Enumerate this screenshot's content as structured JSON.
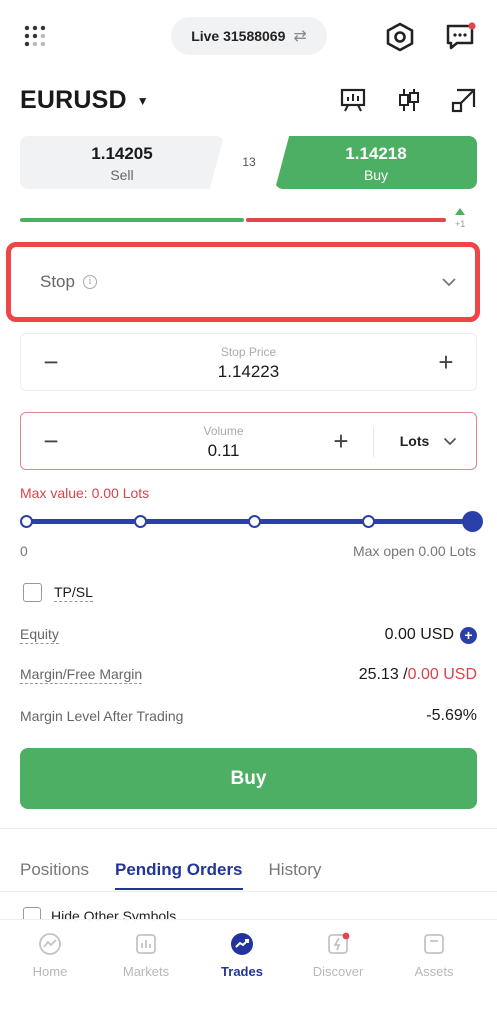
{
  "top_bar": {
    "account_label": "Live 31588069",
    "swap_icon": "⇄"
  },
  "symbol": {
    "name": "EURUSD",
    "caret": "▼"
  },
  "quote": {
    "sell_price": "1.14205",
    "sell_label": "Sell",
    "spread": "13",
    "buy_price": "1.14218",
    "buy_label": "Buy",
    "sentiment_delta": "+1"
  },
  "order_type": {
    "label": "Stop",
    "info_glyph": "i"
  },
  "stop_price": {
    "label": "Stop Price",
    "value": "1.14223",
    "minus": "−",
    "plus": "+"
  },
  "volume": {
    "label": "Volume",
    "value": "0.11",
    "minus": "−",
    "plus": "+",
    "unit": "Lots"
  },
  "validation": {
    "max_value": "Max value: 0.00 Lots"
  },
  "slider": {
    "min_label": "0",
    "max_label": "Max open 0.00 Lots",
    "level": 1.0
  },
  "tpsl": {
    "label": "TP/SL",
    "checked": false
  },
  "account_info": {
    "equity_label": "Equity",
    "equity_value": "0.00 USD",
    "margin_label": "Margin/Free Margin",
    "margin_value": "25.13 /",
    "free_margin_value": "0.00 USD",
    "margin_level_label": "Margin Level After Trading",
    "margin_level_value": "-5.69%"
  },
  "action": {
    "buy_label": "Buy"
  },
  "tabs": [
    {
      "label": "Positions",
      "active": false
    },
    {
      "label": "Pending Orders",
      "active": true
    },
    {
      "label": "History",
      "active": false
    }
  ],
  "filter": {
    "hide_other_label": "Hide Other Symbols"
  },
  "bottom_nav": [
    {
      "label": "Home",
      "icon": "home-chart-icon",
      "active": false
    },
    {
      "label": "Markets",
      "icon": "markets-icon",
      "active": false
    },
    {
      "label": "Trades",
      "icon": "trades-icon",
      "active": true
    },
    {
      "label": "Discover",
      "icon": "discover-icon",
      "active": false
    },
    {
      "label": "Assets",
      "icon": "assets-icon",
      "active": false
    }
  ],
  "colors": {
    "buy_green": "#4caf63",
    "sell_red": "#e0464c",
    "accent_blue": "#23349c",
    "highlight_red": "#ec4646"
  }
}
